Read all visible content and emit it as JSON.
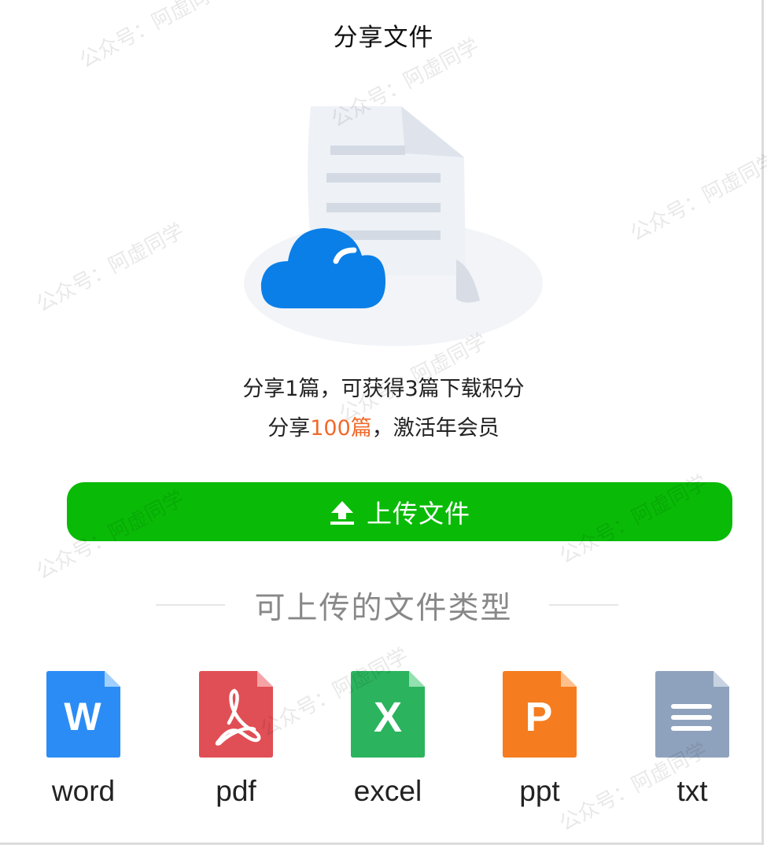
{
  "header": {
    "title": "分享文件"
  },
  "intro": {
    "line1": "分享1篇，可获得3篇下载积分",
    "line2_prefix": "分享",
    "line2_highlight": "100篇",
    "line2_suffix": "，激活年会员"
  },
  "upload_button": {
    "label": "上传文件",
    "icon": "upload-icon"
  },
  "file_types": {
    "heading": "可上传的文件类型",
    "items": [
      {
        "label": "word",
        "glyph": "W",
        "color": "#2b8cf6",
        "icon": "word-file-icon"
      },
      {
        "label": "pdf",
        "glyph": "",
        "color": "#e04f55",
        "icon": "pdf-file-icon"
      },
      {
        "label": "excel",
        "glyph": "X",
        "color": "#2bb35e",
        "icon": "excel-file-icon"
      },
      {
        "label": "ppt",
        "glyph": "P",
        "color": "#f57c1f",
        "icon": "ppt-file-icon"
      },
      {
        "label": "txt",
        "glyph": "",
        "color": "#8fa2bd",
        "icon": "txt-file-icon"
      }
    ]
  },
  "watermark": {
    "text": "公众号：阿虚同学"
  },
  "colors": {
    "accent_green": "#09bb07",
    "highlight_orange": "#f06a2a",
    "cloud_blue": "#0a7fe8"
  }
}
